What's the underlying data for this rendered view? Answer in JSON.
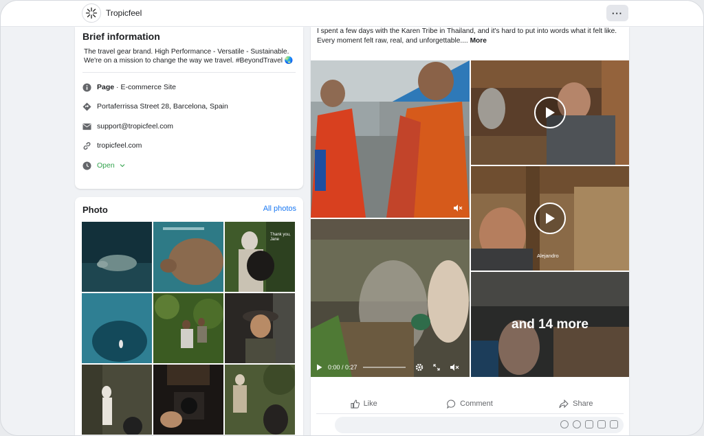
{
  "header": {
    "page_name": "Tropicfeel",
    "more_label": "···",
    "brand_icon": "sun-asterisk-logo"
  },
  "info": {
    "title": "Brief information",
    "description": "The travel gear brand. High Performance - Versatile - Sustainable. We're on a mission to change the way we travel. #BeyondTravel 🌏",
    "category_label": "Page",
    "category_value": " · E-commerce Site",
    "address": "Portaferrissa Street 28, Barcelona, Spain",
    "email": "support@tropicfeel.com",
    "website": "tropicfeel.com",
    "hours": "Open",
    "open_color": "#31a24c"
  },
  "photos": {
    "title": "Photo",
    "all_link": "All photos",
    "captions": [
      "",
      "",
      "Thank you, Jane",
      "",
      "",
      "",
      "",
      "",
      ""
    ]
  },
  "post": {
    "text_line1": "I spent a few days with the Karen Tribe in Thailand, and it's hard to put into words what it felt like.",
    "text_line2": "Every moment felt raw, real, and unforgettable....",
    "more_label": "More",
    "video_time": "0:00 / 0:27",
    "video_progress": 0,
    "tile_caption": "Alejandro",
    "more_overlay": "and 14 more",
    "actions": {
      "like": "Like",
      "comment": "Comment",
      "share": "Share"
    }
  },
  "colors": {
    "accent": "#1877f2",
    "background": "#f0f2f5"
  }
}
